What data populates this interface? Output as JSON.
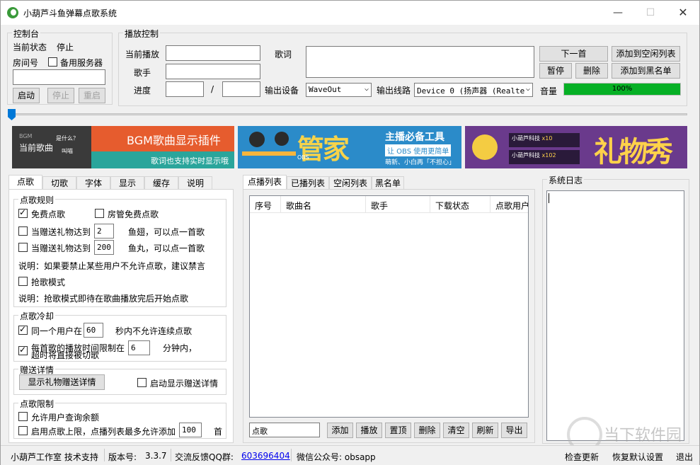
{
  "titlebar": {
    "title": "小葫芦斗鱼弹幕点歌系统"
  },
  "control": {
    "group_title": "控制台",
    "status_label": "当前状态",
    "status_value": "停止",
    "room_label": "房间号",
    "backup_label": "备用服务器",
    "room_value": "",
    "start": "启动",
    "stop": "停止",
    "restart": "重启"
  },
  "playback": {
    "group_title": "播放控制",
    "current_label": "当前播放",
    "singer_label": "歌手",
    "progress_label": "进度",
    "slash": "/",
    "lyrics_label": "歌词",
    "output_device_label": "输出设备",
    "output_device_value": "WaveOut",
    "output_line_label": "输出线路",
    "output_line_value": "Device 0 (扬声器 (Realte",
    "volume_label": "音量",
    "volume_value": "100%",
    "volume_fraction": 1.0,
    "next": "下一首",
    "add_idle": "添加到空闲列表",
    "pause": "暂停",
    "delete": "删除",
    "add_black": "添加到黑名单"
  },
  "banners": {
    "b1_title": "BGM歌曲显示插件",
    "b1_sub": "歌词也支持实时显示哦",
    "b1_left": "当前歌曲",
    "b1_small": "BGM",
    "b1_q": "是什么？",
    "b1_who": "叫喵",
    "b2_brand": "管家",
    "b2_obs": "OBS",
    "b2_title": "主播必备工具",
    "b2_sub": "让 OBS 使用更简单",
    "b2_sub2": "萌新、小白再「不担心」",
    "b3_title": "礼物秀",
    "b3_a": "小葫芦科技",
    "b3_b": "x10",
    "b3_c": "小葫芦科技",
    "b3_d": "x102"
  },
  "left_tabs": [
    "点歌",
    "切歌",
    "字体",
    "显示",
    "缓存",
    "说明"
  ],
  "rules": {
    "group_title": "点歌规则",
    "free_label": "免费点歌",
    "admin_free_label": "房管免费点歌",
    "gift1_label": "当赠送礼物达到",
    "gift1_value": "2",
    "gift1_suffix": "鱼翅，可以点一首歌",
    "gift2_label": "当赠送礼物达到",
    "gift2_value": "200",
    "gift2_suffix": "鱼丸，可以点一首歌",
    "note1": "说明：如果要禁止某些用户不允许点歌，建议禁言",
    "grab_label": "抢歌模式",
    "note2": "说明：抢歌模式即待在歌曲播放完后开始点歌"
  },
  "cooldown": {
    "group_title": "点歌冷却",
    "same_user_label": "同一个用户在",
    "same_user_value": "60",
    "same_user_suffix": "秒内不允许连续点歌",
    "limit_label_1": "每首歌的播放时间限制在",
    "limit_label_2": "超时将直接被切歌",
    "limit_value": "6",
    "limit_suffix": "分钟内，"
  },
  "gift_detail": {
    "group_title": "赠送详情",
    "show_btn": "显示礼物赠送详情",
    "startup_label": "启动显示赠送详情"
  },
  "limit": {
    "group_title": "点歌限制",
    "query_label": "允许用户查询余额",
    "cap_label": "启用点歌上限，点播列表最多允许添加",
    "cap_value": "100",
    "cap_suffix": "首"
  },
  "list_tabs": [
    "点播列表",
    "已播列表",
    "空闲列表",
    "黑名单"
  ],
  "list_columns": [
    "序号",
    "歌曲名",
    "歌手",
    "下载状态",
    "点歌用户"
  ],
  "list_input": "点歌",
  "list_buttons": [
    "添加",
    "播放",
    "置顶",
    "删除",
    "清空",
    "刷新",
    "导出"
  ],
  "syslog": {
    "group_title": "系统日志"
  },
  "status": {
    "studio": "小葫芦工作室 技术支持",
    "version_label": "版本号:",
    "version_value": "3.3.7",
    "qq_label": "交流反馈QQ群:",
    "qq_value": "603696404",
    "wechat_label": "微信公众号: obsapp",
    "check_update": "检查更新",
    "restore": "恢复默认设置",
    "exit": "退出"
  },
  "watermark": "当下软件园"
}
